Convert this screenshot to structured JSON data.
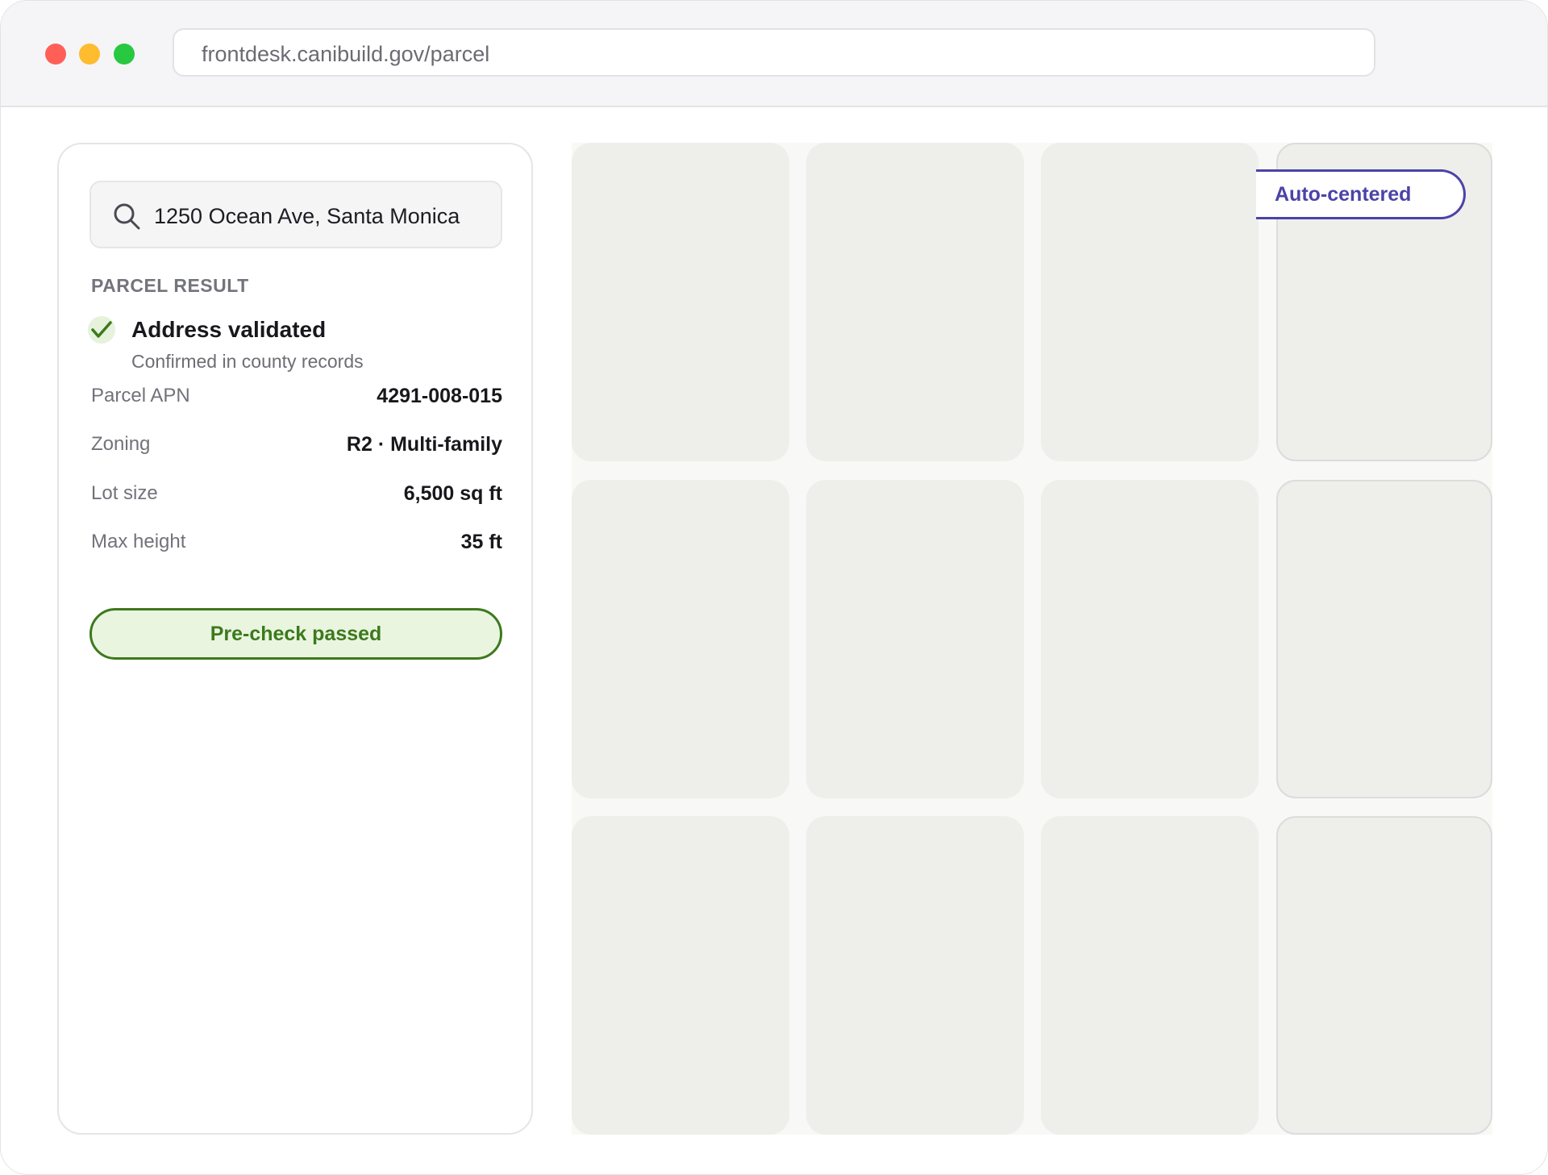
{
  "browser": {
    "url": "frontdesk.canibuild.gov/parcel"
  },
  "search": {
    "value": "1250 Ocean Ave, Santa Monica"
  },
  "parcel": {
    "section_title": "PARCEL RESULT",
    "status_title": "Address validated",
    "status_subtitle": "Confirmed in county records",
    "rows": [
      {
        "label": "Parcel APN",
        "value": "4291-008-015"
      },
      {
        "label": "Zoning",
        "value": "R2 · Multi-family"
      },
      {
        "label": "Lot size",
        "value": "6,500 sq ft"
      },
      {
        "label": "Max height",
        "value": "35 ft"
      }
    ],
    "precheck_label": "Pre-check passed"
  },
  "map": {
    "badge_label": "Auto-centered"
  },
  "colors": {
    "success": "#3c7a1c",
    "accent": "#4b43a8"
  }
}
